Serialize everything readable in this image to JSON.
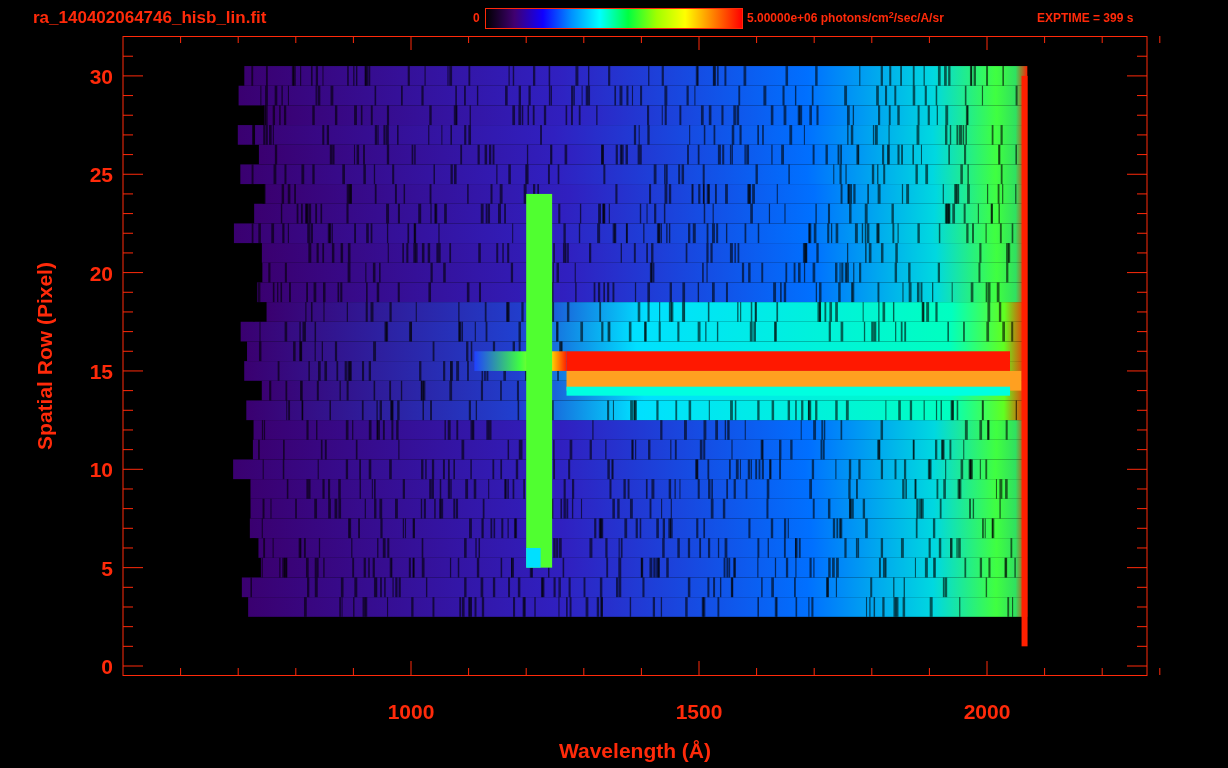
{
  "title": "ra_140402064746_hisb_lin.fit",
  "colorbar": {
    "min_label": "0",
    "max_label": "5.00000e+06 photons/cm$^{2}$/sec/A/sr"
  },
  "exposure": "EXPTIME = 399 s",
  "plot": {
    "xlabel": "Wavelength (Å)",
    "ylabel": "Spatial Row (Pixel)",
    "xticks": [
      "1000",
      "1500",
      "2000"
    ],
    "yticks": [
      "30",
      "25",
      "20",
      "15",
      "10",
      "5",
      "0"
    ]
  }
}
